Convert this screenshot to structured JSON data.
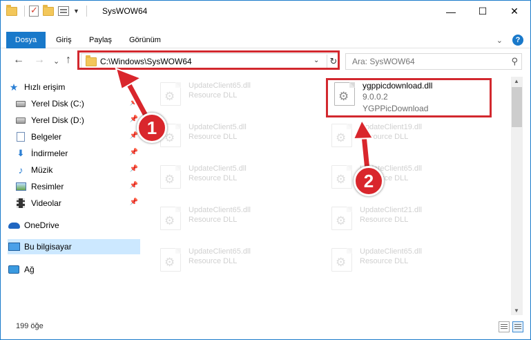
{
  "titlebar": {
    "title": "SysWOW64",
    "controls": {
      "minimize": "—",
      "maximize": "☐",
      "close": "✕"
    }
  },
  "ribbon": {
    "tabs": [
      "Dosya",
      "Giriş",
      "Paylaş",
      "Görünüm"
    ],
    "expand_glyph": "⌄",
    "help": "?"
  },
  "nav": {
    "back": "←",
    "forward": "→",
    "recent": "⌄",
    "up": "↑",
    "address": "C:\\Windows\\SysWOW64",
    "address_dropdown": "⌄",
    "refresh": "↻",
    "search_placeholder": "Ara: SysWOW64",
    "search_glyph": "⚲"
  },
  "sidebar": {
    "items": [
      {
        "label": "Hızlı erişim",
        "icon": "star-icon",
        "pinned": false
      },
      {
        "label": "Yerel Disk (C:)",
        "icon": "drive-icon",
        "pinned": true
      },
      {
        "label": "Yerel Disk (D:)",
        "icon": "drive-icon",
        "pinned": true
      },
      {
        "label": "Belgeler",
        "icon": "document-icon",
        "pinned": true
      },
      {
        "label": "İndirmeler",
        "icon": "download-icon",
        "pinned": true
      },
      {
        "label": "Müzik",
        "icon": "music-icon",
        "pinned": true
      },
      {
        "label": "Resimler",
        "icon": "pictures-icon",
        "pinned": true
      },
      {
        "label": "Videolar",
        "icon": "videos-icon",
        "pinned": true
      },
      {
        "label": "OneDrive",
        "icon": "onedrive-icon",
        "pinned": false
      },
      {
        "label": "Bu bilgisayar",
        "icon": "computer-icon",
        "pinned": false,
        "selected": true
      },
      {
        "label": "Ağ",
        "icon": "network-icon",
        "pinned": false
      }
    ],
    "pin_glyph": "📌"
  },
  "files": {
    "highlighted": {
      "name": "ygppicdownload.dll",
      "version": "9.0.0.2",
      "description": "YGPPicDownload"
    },
    "faded": [
      {
        "name": "UpdateClient65.dll",
        "type": "Resource DLL"
      },
      {
        "name": "UpdateClient5.dll",
        "type": "Resource DLL"
      },
      {
        "name": "UpdateClient19.dll",
        "type": "Resource DLL"
      },
      {
        "name": "UpdateClient5.dll",
        "type": "Resource DLL"
      },
      {
        "name": "UpdateClient65.dll",
        "type": "Resource DLL"
      },
      {
        "name": "UpdateClient65.dll",
        "type": "Resource DLL"
      },
      {
        "name": "UpdateClient21.dll",
        "type": "Resource DLL"
      },
      {
        "name": "UpdateClient65.dll",
        "type": "Resource DLL"
      },
      {
        "name": "UpdateClient65.dll",
        "type": "Resource DLL"
      }
    ],
    "gear_glyph": "⚙"
  },
  "scrollbar": {
    "up": "▲",
    "down": "▼"
  },
  "status": {
    "item_count": "199 öğe"
  },
  "annotations": {
    "step1": "1",
    "step2": "2",
    "color": "#d9262c"
  },
  "colors": {
    "accent": "#1979ca",
    "highlight": "#d2282e",
    "selection": "#cce8ff"
  }
}
